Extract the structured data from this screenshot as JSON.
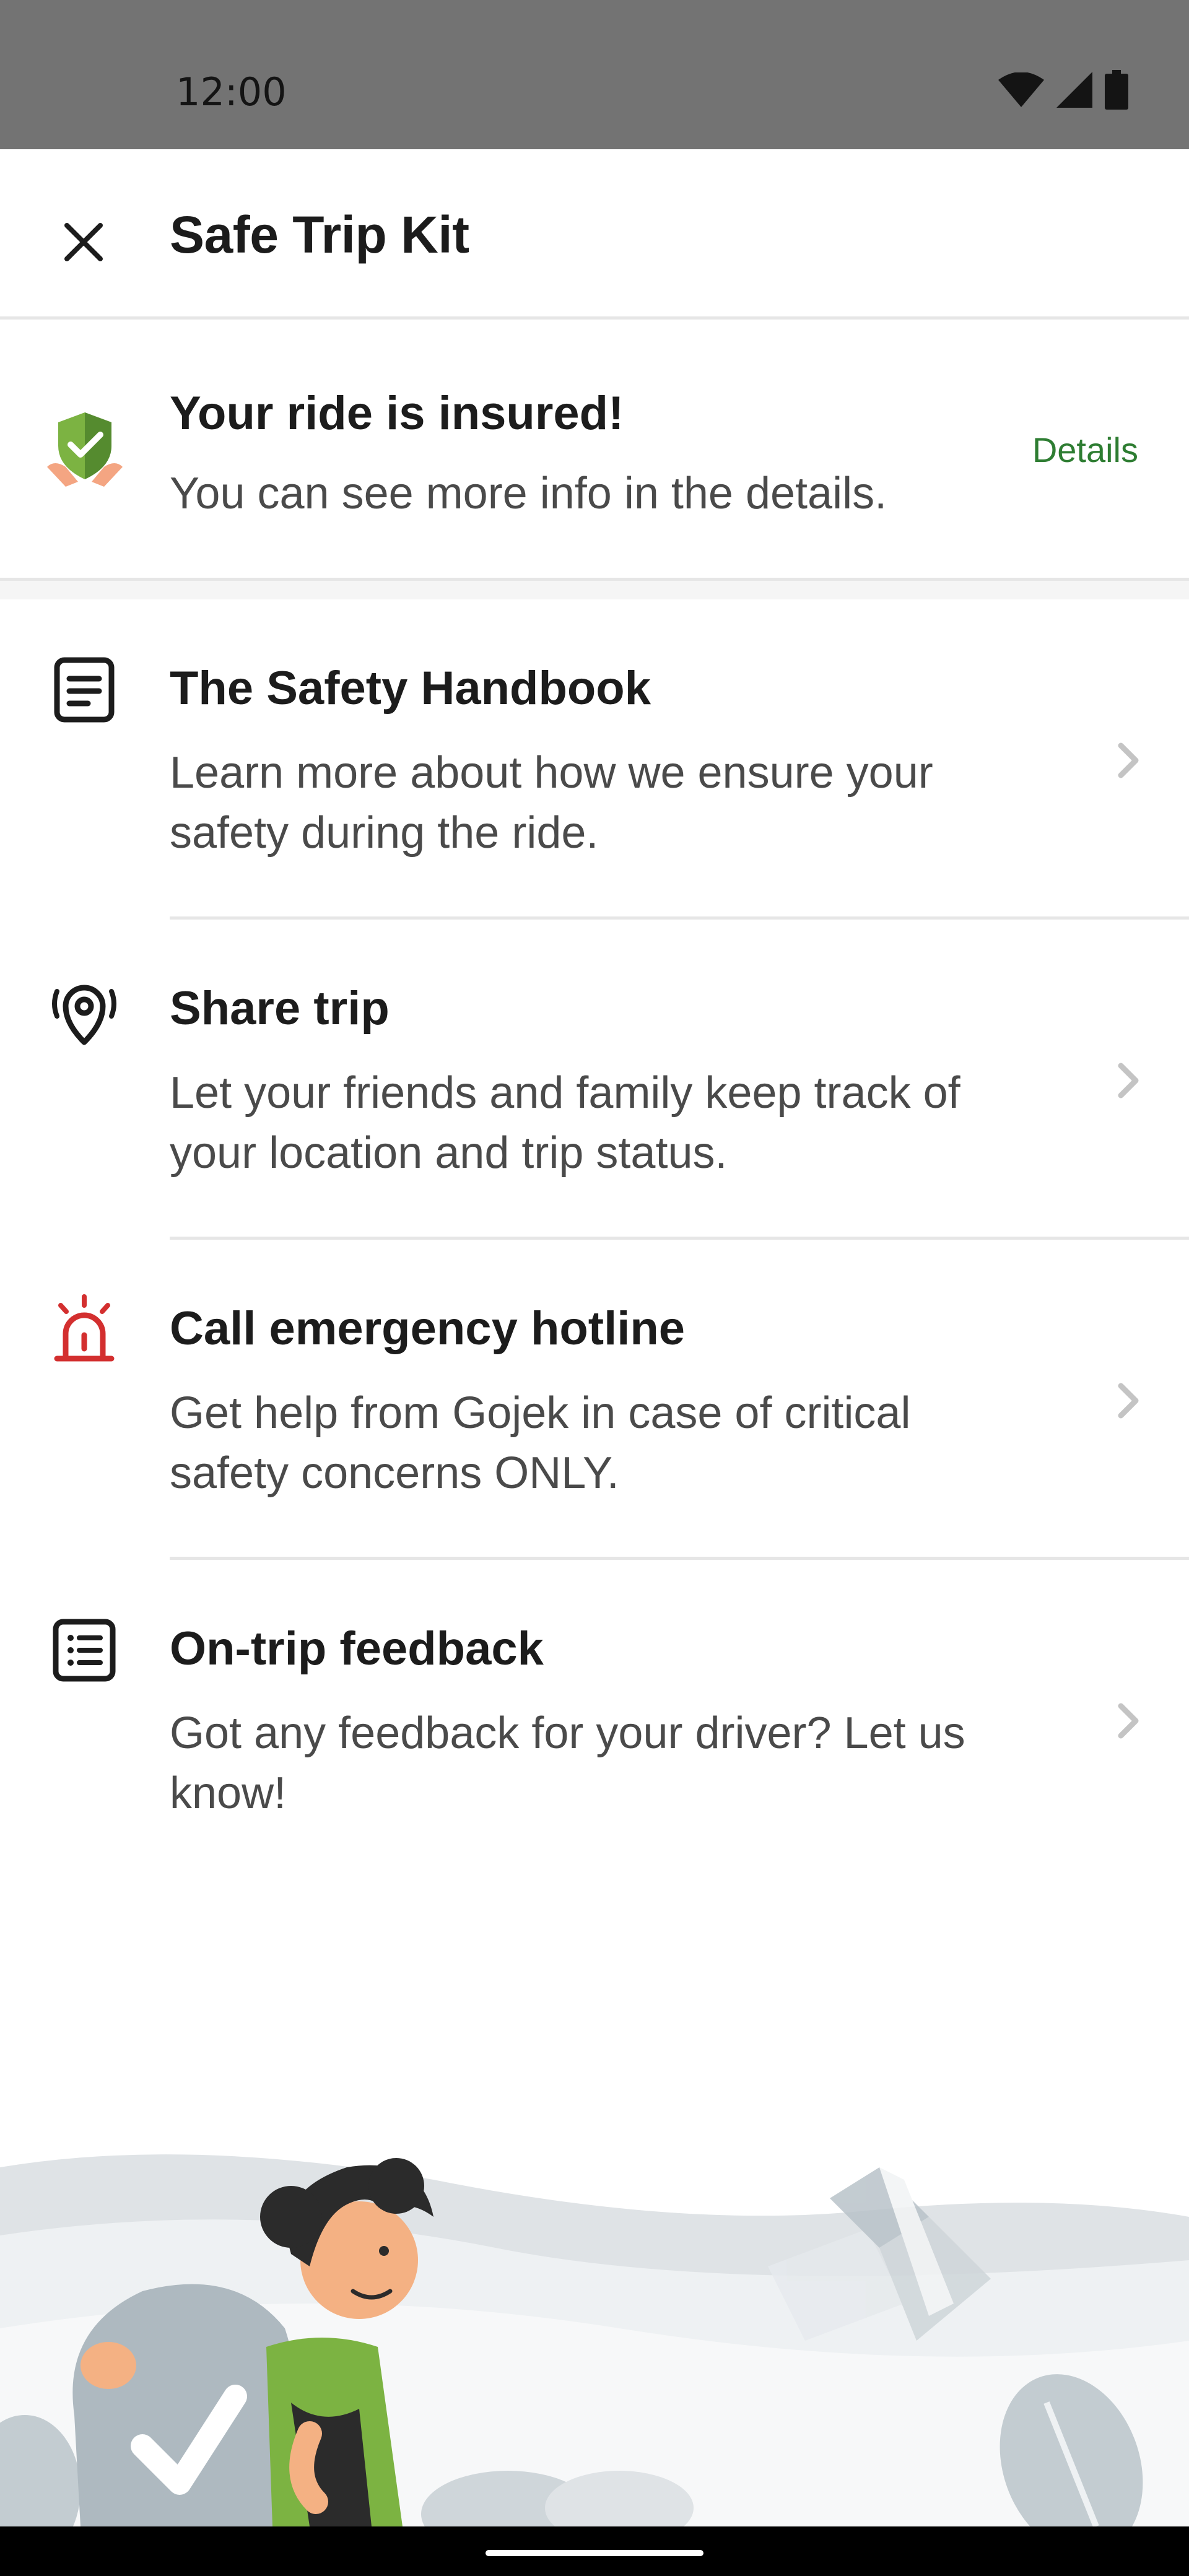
{
  "status_bar": {
    "time": "12:00",
    "icons": [
      "wifi-icon",
      "signal-icon",
      "battery-icon"
    ]
  },
  "app_bar": {
    "close_icon": "close-icon",
    "title": "Safe Trip Kit"
  },
  "insurance": {
    "icon": "insurance-shield-icon",
    "title": "Your ride is insured!",
    "subtitle": "You can see more info in the details.",
    "details_label": "Details"
  },
  "items": [
    {
      "icon": "handbook-icon",
      "title": "The Safety Handbook",
      "description": "Learn more about how we ensure your safety during the ride."
    },
    {
      "icon": "location-share-icon",
      "title": "Share trip",
      "description": "Let your friends and family keep track of your location and trip status."
    },
    {
      "icon": "emergency-siren-icon",
      "title": "Call emergency hotline",
      "description": "Get help from Gojek in case of critical safety concerns ONLY."
    },
    {
      "icon": "feedback-checklist-icon",
      "title": "On-trip feedback",
      "description": "Got any feedback for your driver? Let us know!"
    }
  ],
  "colors": {
    "accent_green": "#2e7d32",
    "emergency_red": "#d32f2f",
    "status_bar": "#737373"
  }
}
